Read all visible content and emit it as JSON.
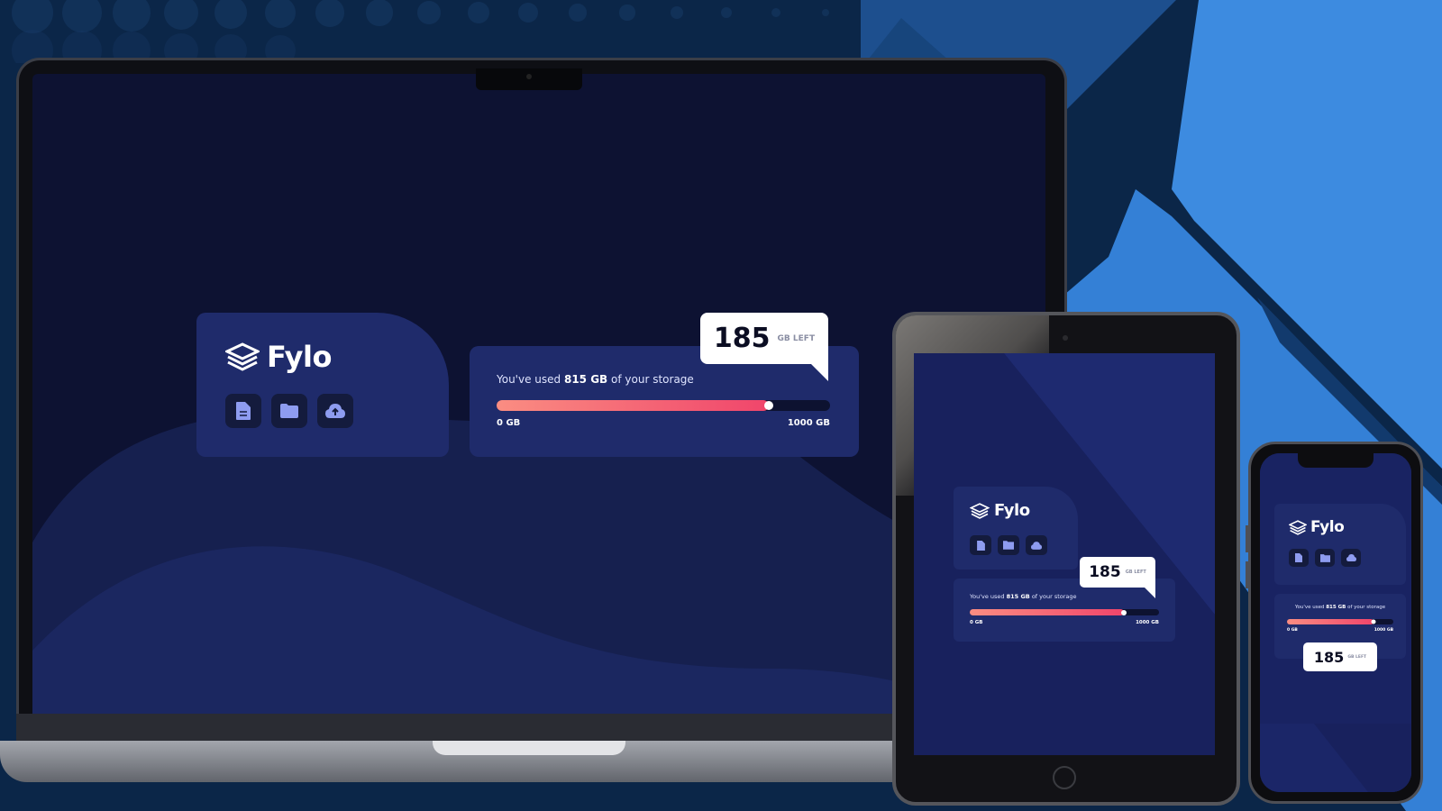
{
  "app": {
    "name": "Fylo",
    "used_prefix": "You've used",
    "used_amount": "815 GB",
    "used_suffix": "of your storage",
    "min_label": "0 GB",
    "max_label": "1000 GB",
    "remaining_value": "185",
    "remaining_unit": "GB LEFT",
    "used_fraction": 0.815,
    "icons": [
      "document-icon",
      "folder-icon",
      "cloud-upload-icon"
    ]
  },
  "devices": [
    "laptop",
    "tablet",
    "phone"
  ],
  "colors": {
    "page_bg": "#0b2648",
    "accent_blue": "#3d8be0",
    "panel": "#1f2b6b",
    "screen_bg": "#0d1232",
    "bar_start": "#fa8d82",
    "bar_end": "#f0456b",
    "icon_tint": "#8e9cf0"
  }
}
